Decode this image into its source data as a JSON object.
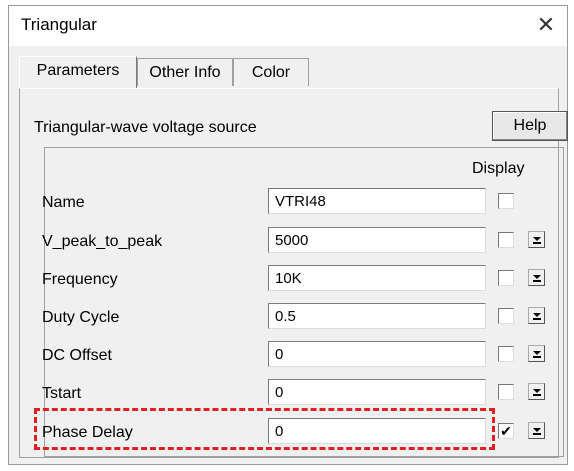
{
  "window": {
    "title": "Triangular",
    "close_symbol": "✕"
  },
  "tabs": [
    {
      "label": "Parameters",
      "active": true
    },
    {
      "label": "Other Info",
      "active": false
    },
    {
      "label": "Color",
      "active": false
    }
  ],
  "subtitle": "Triangular-wave voltage source",
  "help_label": "Help",
  "display_header": "Display",
  "params": [
    {
      "label": "Name",
      "value": "VTRI48",
      "display_checked": false,
      "has_dropdown": false
    },
    {
      "label": "V_peak_to_peak",
      "value": "5000",
      "display_checked": false,
      "has_dropdown": true
    },
    {
      "label": "Frequency",
      "value": "10K",
      "display_checked": false,
      "has_dropdown": true
    },
    {
      "label": "Duty Cycle",
      "value": "0.5",
      "display_checked": false,
      "has_dropdown": true
    },
    {
      "label": "DC Offset",
      "value": "0",
      "display_checked": false,
      "has_dropdown": true
    },
    {
      "label": "Tstart",
      "value": "0",
      "display_checked": false,
      "has_dropdown": true
    },
    {
      "label": "Phase Delay",
      "value": "0",
      "display_checked": true,
      "has_dropdown": true
    }
  ],
  "highlight_color": "#e02020",
  "check_mark": "✔"
}
